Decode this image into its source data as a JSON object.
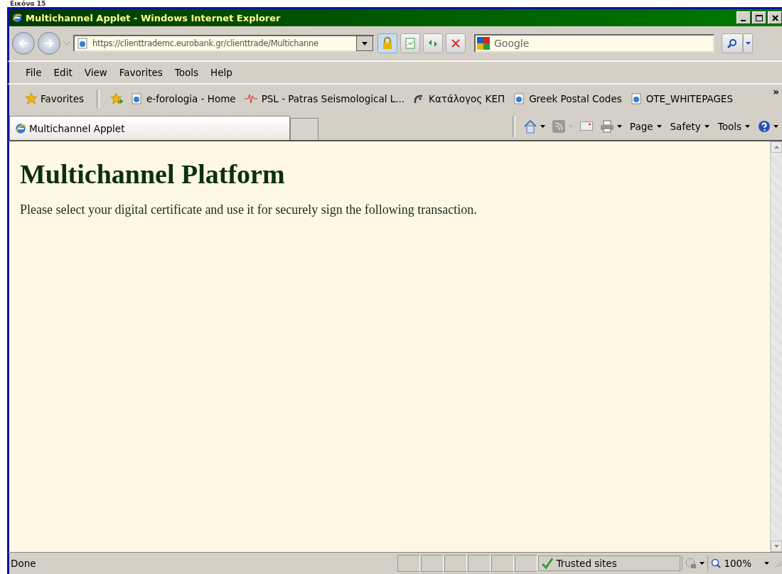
{
  "caption": "Εικόνα 15",
  "window": {
    "title": "Multichannel Applet - Windows Internet Explorer"
  },
  "address_bar": {
    "url": "https://clienttrademc.eurobank.gr/clienttrade/Multichanne",
    "search_placeholder": "Google"
  },
  "menu": [
    "File",
    "Edit",
    "View",
    "Favorites",
    "Tools",
    "Help"
  ],
  "favorites_bar": {
    "favorites_button": "Favorites",
    "links": [
      {
        "label": "e-forologia - Home",
        "kind": "ie"
      },
      {
        "label": "PSL - Patras Seismological L...",
        "kind": "seismo"
      },
      {
        "label": "Κατάλογος ΚΕΠ",
        "kind": "kep"
      },
      {
        "label": "Greek Postal Codes",
        "kind": "ie"
      },
      {
        "label": "OTE_WHITEPAGES",
        "kind": "ie"
      }
    ],
    "overflow": "»"
  },
  "tabs": [
    {
      "label": "Multichannel Applet",
      "selected": true
    }
  ],
  "command_bar": [
    "Page",
    "Safety",
    "Tools"
  ],
  "page": {
    "heading": "Multichannel Platform",
    "text": "Please select your digital certificate and use it for securely sign the following transaction."
  },
  "status_bar": {
    "text": "Done",
    "zone": "Trusted sites",
    "zoom": "100%"
  }
}
